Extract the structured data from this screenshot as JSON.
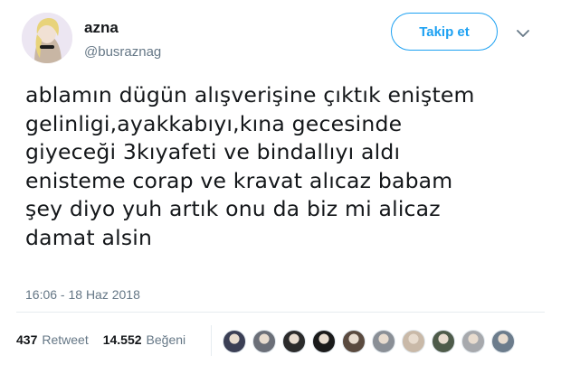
{
  "user": {
    "display_name": "azna",
    "handle": "@busraznag"
  },
  "follow_button": {
    "label": "Takip et"
  },
  "tweet": {
    "lines": [
      "ablamın dügün alışverişine çıktık eniştem",
      "gelinligi,ayakkabıyı,kına gecesinde",
      "giyeceği 3kıyafeti ve bindallıyı aldı",
      "enisteme corap ve kravat alıcaz babam",
      "şey diyo yuh artık onu da biz mi alicaz",
      "damat alsin"
    ],
    "timestamp": "16:06 - 18 Haz 2018"
  },
  "stats": {
    "retweet_count": "437",
    "retweet_label": "Retweet",
    "like_count": "14.552",
    "like_label": "Beğeni"
  },
  "likers": [
    {
      "name": "liker-avatar-1",
      "color": "#3b3f55"
    },
    {
      "name": "liker-avatar-2",
      "color": "#6b6f78"
    },
    {
      "name": "liker-avatar-3",
      "color": "#2b2b2b"
    },
    {
      "name": "liker-avatar-4",
      "color": "#1a1a1a"
    },
    {
      "name": "liker-avatar-5",
      "color": "#5a4a3f"
    },
    {
      "name": "liker-avatar-6",
      "color": "#8a8f96"
    },
    {
      "name": "liker-avatar-7",
      "color": "#c9b9a8"
    },
    {
      "name": "liker-avatar-8",
      "color": "#4e5b4a"
    },
    {
      "name": "liker-avatar-9",
      "color": "#a7a9ad"
    },
    {
      "name": "liker-avatar-10",
      "color": "#6c7c8c"
    }
  ],
  "colors": {
    "accent": "#1da1f2",
    "text": "#14171a",
    "secondary": "#657786",
    "divider": "#e6ecf0"
  }
}
